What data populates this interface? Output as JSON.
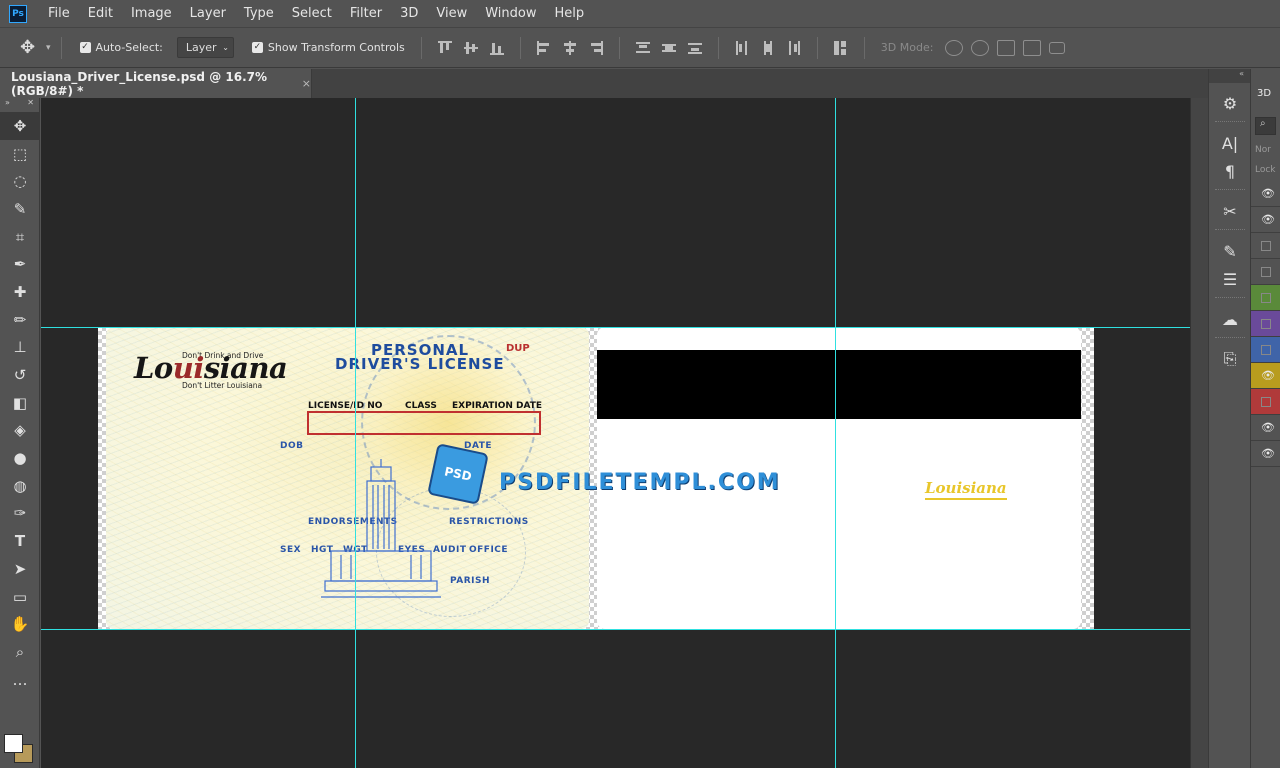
{
  "app": {
    "logo": "Ps"
  },
  "menu": [
    "File",
    "Edit",
    "Image",
    "Layer",
    "Type",
    "Select",
    "Filter",
    "3D",
    "View",
    "Window",
    "Help"
  ],
  "options": {
    "auto_select_label": "Auto-Select:",
    "auto_select_value": "Layer",
    "show_transform_label": "Show Transform Controls",
    "mode_3d_label": "3D Mode:"
  },
  "document": {
    "tab_title": "Lousiana_Driver_License.psd @ 16.7% (RGB/8#) *",
    "close": "×"
  },
  "license_front": {
    "state_logo": "Louisiana",
    "tagline_top": "Don't Drink and Drive",
    "tagline_bottom": "Don't Litter Louisiana",
    "header_line1": "PERSONAL",
    "header_line2": "DRIVER'S LICENSE",
    "dup": "DUP",
    "license_no": "LICENSE/ID NO",
    "class": "CLASS",
    "expiration": "EXPIRATION DATE",
    "dob": "DOB",
    "date": "DATE",
    "endorsements": "ENDORSEMENTS",
    "restrictions": "RESTRICTIONS",
    "sex": "SEX",
    "hgt": "HGT",
    "wgt": "WGT",
    "eyes": "EYES",
    "audit": "AUDIT",
    "office": "OFFICE",
    "parish": "PARISH"
  },
  "license_back": {
    "logo": "Louisiana"
  },
  "watermark": {
    "badge": "PSD",
    "text": "PSDFILETEMPL.COM"
  },
  "panel": {
    "tab": "3D",
    "search_placeholder": "⌕",
    "blend": "Nor",
    "lock": "Lock"
  },
  "layers": [
    {
      "visible": true,
      "color": ""
    },
    {
      "visible": true,
      "color": ""
    },
    {
      "visible": false,
      "color": ""
    },
    {
      "visible": false,
      "color": ""
    },
    {
      "visible": false,
      "color": "#5a8a3a"
    },
    {
      "visible": false,
      "color": "#6a4a9a"
    },
    {
      "visible": false,
      "color": "#3f64a8"
    },
    {
      "visible": true,
      "color": "#b89c1e"
    },
    {
      "visible": false,
      "color": "#b03a3a"
    },
    {
      "visible": true,
      "color": ""
    },
    {
      "visible": true,
      "color": ""
    }
  ],
  "colors": {
    "foreground": "#ffffff",
    "background": "#b79a5a",
    "guide": "#2fe0e0"
  }
}
